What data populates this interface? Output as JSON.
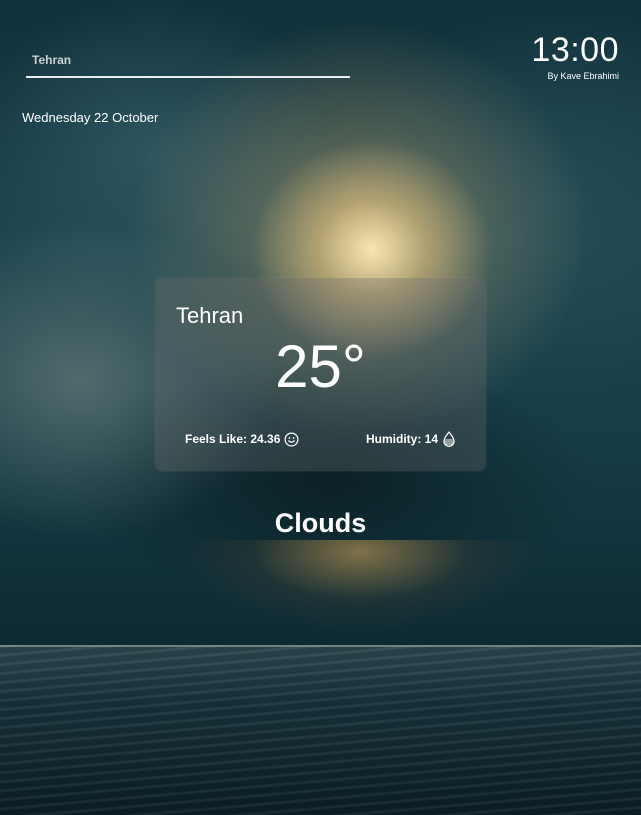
{
  "search": {
    "value": "",
    "placeholder": "Tehran"
  },
  "clock": {
    "time": "13:00",
    "author": "By Kave Ebrahimi"
  },
  "date": "Wednesday 22 October",
  "weather": {
    "city": "Tehran",
    "temperature": "25°",
    "feels_like_label": "Feels Like: 24.36",
    "feels_like_icon": "smile-icon",
    "humidity_label": "Humidity: 14",
    "humidity_icon": "droplet-icon",
    "condition": "Clouds"
  }
}
